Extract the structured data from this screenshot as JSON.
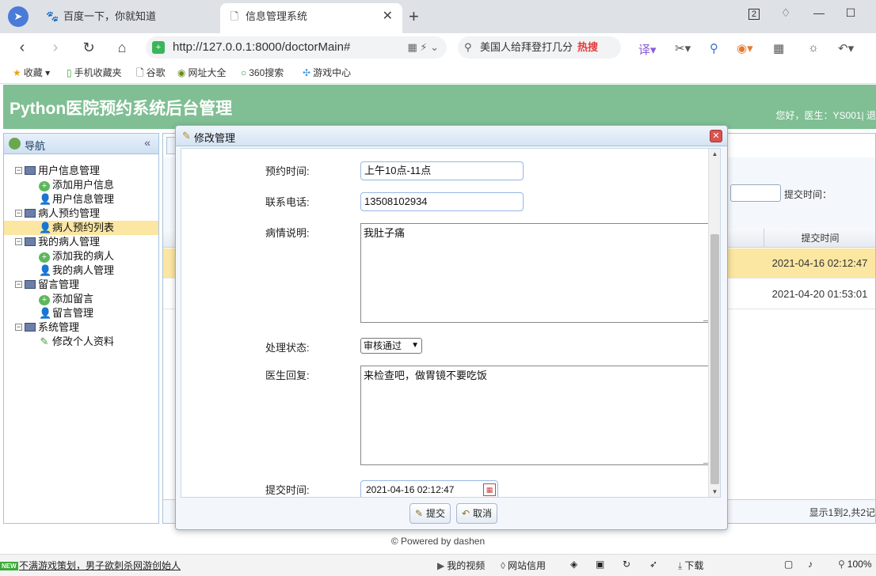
{
  "browser": {
    "tabs": [
      {
        "title": "百度一下，你就知道",
        "icon": "paw-icon"
      },
      {
        "title": "信息管理系统",
        "icon": "page-icon"
      }
    ],
    "tab_count": "2",
    "url": "http://127.0.0.1:8000/doctorMain#",
    "search_text": "美国人给拜登打几分",
    "search_hot": "热搜",
    "bookmarks": [
      "收藏",
      "手机收藏夹",
      "谷歌",
      "网址大全",
      "360搜索",
      "游戏中心"
    ]
  },
  "header": {
    "title": "Python医院预约系统后台管理",
    "user_text": "您好，医生：YS001| 退"
  },
  "sidebar": {
    "title": "导航",
    "items": [
      {
        "label": "用户信息管理"
      },
      {
        "label": "添加用户信息"
      },
      {
        "label": "用户信息管理"
      },
      {
        "label": "病人预约管理"
      },
      {
        "label": "病人预约列表"
      },
      {
        "label": "我的病人管理"
      },
      {
        "label": "添加我的病人"
      },
      {
        "label": "我的病人管理"
      },
      {
        "label": "留言管理"
      },
      {
        "label": "添加留言"
      },
      {
        "label": "留言管理"
      },
      {
        "label": "系统管理"
      },
      {
        "label": "修改个人资料"
      }
    ]
  },
  "content": {
    "filter_label": "提交时间：",
    "column_header": "提交时间",
    "rows": [
      {
        "submit_time": "2021-04-16 02:12:47"
      },
      {
        "submit_time": "2021-04-20 01:53:01"
      }
    ],
    "pager_info": "显示1到2,共2记"
  },
  "dialog": {
    "title": "修改管理",
    "fields": {
      "appointment_time": {
        "label": "预约时间:",
        "value": "上午10点-11点"
      },
      "phone": {
        "label": "联系电话:",
        "value": "13508102934"
      },
      "condition": {
        "label": "病情说明:",
        "value": "我肚子痛"
      },
      "status": {
        "label": "处理状态:",
        "value": "审核通过"
      },
      "reply": {
        "label": "医生回复:",
        "value": "来检查吧，做胃镜不要吃饭"
      },
      "submit_time": {
        "label": "提交时间:",
        "value": "2021-04-16 02:12:47"
      }
    },
    "buttons": {
      "submit": "提交",
      "cancel": "取消"
    }
  },
  "footer": {
    "powered": "© Powered by dashen"
  },
  "statusbar": {
    "badge": "NEW",
    "news": "不满游戏策划，男子欲刺杀网游创始人",
    "items": [
      "我的视频",
      "网站信用",
      "下载",
      "100%"
    ]
  },
  "colors": {
    "header_green": "#7fbf93",
    "highlight_row": "#fbe6a2",
    "panel_border": "#a7c3dc",
    "close_red": "#d9534f"
  }
}
